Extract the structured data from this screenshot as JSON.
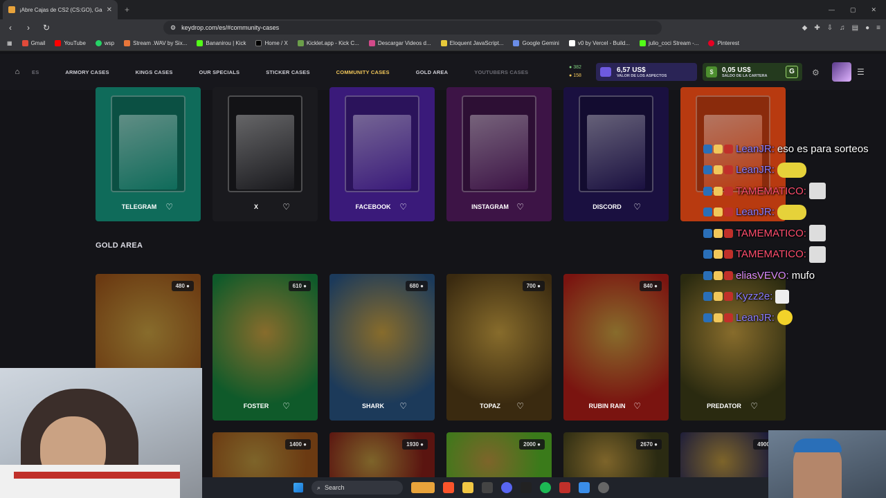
{
  "browser": {
    "tab_title": "¡Abre Cajas de CS2 (CS:GO), Gan",
    "url": "keydrop.com/es/#community-cases",
    "bookmarks": [
      "Gmail",
      "YouTube",
      "wsp",
      "Stream .WAV by Six...",
      "Bananirou | Kick",
      "Home / X",
      "Kicklet.app - Kick C...",
      "Descargar Videos d...",
      "Eloquent JavaScript...",
      "Google Gemini",
      "v0 by Vercel - Build...",
      "julio_coci Stream -...",
      "Pinterest"
    ]
  },
  "header": {
    "nav": [
      "ES",
      "ARMORY CASES",
      "KINGS CASES",
      "OUR SPECIALS",
      "STICKER CASES",
      "COMMUNITY CASES",
      "GOLD AREA",
      "YOUTUBERS CASES"
    ],
    "active_nav": "COMMUNITY CASES",
    "count_green": "382",
    "count_gold": "158",
    "skins_value": "6,57 US$",
    "skins_label": "VALOR DE LOS ASPECTOS",
    "wallet_value": "0,05 US$",
    "wallet_label": "SALDO DE LA CARTERA",
    "wallet_badge": "G"
  },
  "community_cases": [
    {
      "name": "TELEGRAM",
      "bg": "#0f6b5a"
    },
    {
      "name": "X",
      "bg": "#1a1a1e"
    },
    {
      "name": "FACEBOOK",
      "bg": "#3a1a7a"
    },
    {
      "name": "INSTAGRAM",
      "bg": "#3d1446"
    },
    {
      "name": "DISCORD",
      "bg": "#1a1040"
    },
    {
      "name": "",
      "bg": "#b83a10"
    }
  ],
  "gold_area_title": "GOLD AREA",
  "gold_cases": [
    {
      "name": "",
      "price": "480",
      "bg": "#6b3a12"
    },
    {
      "name": "FOSTER",
      "price": "610",
      "bg": "#0f5a2a"
    },
    {
      "name": "SHARK",
      "price": "680",
      "bg": "#1c3a5a"
    },
    {
      "name": "TOPAZ",
      "price": "700",
      "bg": "#3a2a10"
    },
    {
      "name": "RUBIN RAIN",
      "price": "840",
      "bg": "#7a1410"
    },
    {
      "name": "PREDATOR",
      "price": "",
      "bg": "#2a2a10"
    }
  ],
  "gold_row2": [
    {
      "price": "1400",
      "bg": "#6b3a12"
    },
    {
      "price": "1930",
      "bg": "#5a1410"
    },
    {
      "price": "2000",
      "bg": "#3a7a1a"
    },
    {
      "price": "2670",
      "bg": "#2a2a12"
    },
    {
      "price": "4900",
      "bg": "#1c1c3a"
    }
  ],
  "chat": [
    {
      "user": "LeanJR",
      "color": "#8a7cff",
      "text": "eso es para sorteos",
      "emote": ""
    },
    {
      "user": "LeanJR",
      "color": "#8a7cff",
      "text": "",
      "emote": "yellow"
    },
    {
      "user": "TAMEMATICO",
      "color": "#ff4d6d",
      "text": "",
      "emote": "face"
    },
    {
      "user": "LeanJR",
      "color": "#8a7cff",
      "text": "",
      "emote": "yellow"
    },
    {
      "user": "TAMEMATICO",
      "color": "#ff4d6d",
      "text": "",
      "emote": "face"
    },
    {
      "user": "TAMEMATICO",
      "color": "#ff4d6d",
      "text": "",
      "emote": "face"
    },
    {
      "user": "eliasVEVO",
      "color": "#d98aff",
      "text": "mufo",
      "emote": ""
    },
    {
      "user": "Kyzz2e",
      "color": "#8a7cff",
      "text": "",
      "emote": "tv"
    },
    {
      "user": "LeanJR",
      "color": "#8a7cff",
      "text": "",
      "emote": "smile"
    }
  ],
  "taskbar": {
    "search_label": "Search"
  }
}
